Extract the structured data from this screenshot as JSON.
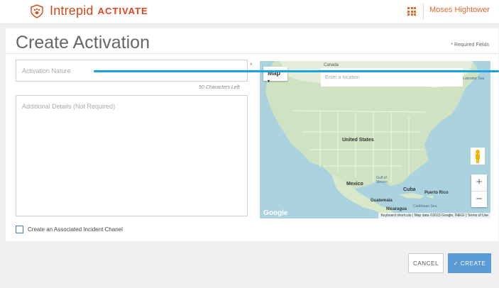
{
  "header": {
    "brand_name": "Intrepid",
    "brand_product": "ACTIVATE",
    "apps_icon": "grid-icon",
    "user_name": "Moses Hightower",
    "brand_color": "#e0441c"
  },
  "page": {
    "title": "Create Activation",
    "required_note": "* Required Fields"
  },
  "form": {
    "nature_placeholder": "Activation Nature",
    "nature_value": "",
    "required_mark": "*",
    "chars_left": "50 Characters Left",
    "details_placeholder": "Additional Details (Not Required)",
    "details_value": "",
    "incident_checkbox_label": "Create an Associated Incident Chanel",
    "incident_checkbox_checked": false
  },
  "map": {
    "type_label": "Map",
    "type_caret": "▾",
    "search_placeholder": "Enter a location",
    "labels": {
      "canada": "Canada",
      "us": "United States",
      "mexico": "Mexico",
      "gulf": "Gulf of Mexico",
      "cuba": "Cuba",
      "puerto_rico": "Puerto Rico",
      "guatemala": "Guatemala",
      "caribbean": "Caribbean Sea",
      "nicaragua": "Nicaragua",
      "labrador": "Labrador Sea"
    },
    "zoom_in": "+",
    "zoom_out": "−",
    "google": "Google",
    "attribution": "Keyboard shortcuts | Map data ©2023 Google, INEGI | Terms of Use",
    "water_color": "#aad3df",
    "land_color": "#cfe3c2"
  },
  "actions": {
    "cancel_label": "CANCEL",
    "create_label": "CREATE",
    "create_icon": "check-icon",
    "create_color": "#5b9bd5"
  },
  "accent": {
    "line_color": "#1ba1e2"
  }
}
